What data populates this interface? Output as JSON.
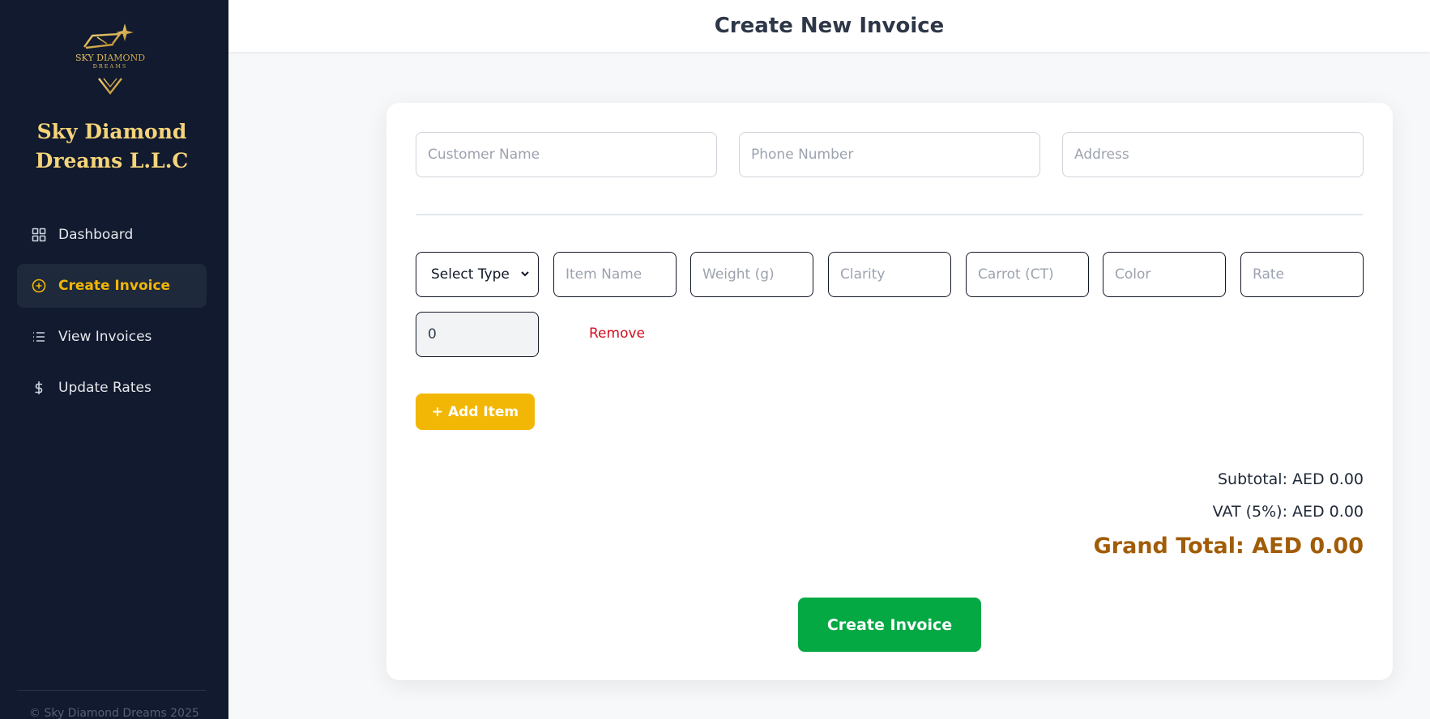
{
  "sidebar": {
    "logo_text": "SKY DIAMOND",
    "logo_subtext": "DREAMS",
    "brand_line1": "Sky Diamond",
    "brand_line2": "Dreams L.L.C",
    "items": [
      {
        "label": "Dashboard",
        "icon": "dashboard-grid-icon",
        "active": false
      },
      {
        "label": "Create Invoice",
        "icon": "plus-circle-icon",
        "active": true
      },
      {
        "label": "View Invoices",
        "icon": "list-icon",
        "active": false
      },
      {
        "label": "Update Rates",
        "icon": "dollar-icon",
        "active": false
      }
    ],
    "footer": "© Sky Diamond Dreams 2025"
  },
  "header": {
    "title": "Create New Invoice"
  },
  "customer": {
    "name_placeholder": "Customer Name",
    "phone_placeholder": "Phone Number",
    "address_placeholder": "Address"
  },
  "item_row": {
    "type_selected": "Select Type",
    "item_name_placeholder": "Item Name",
    "weight_placeholder": "Weight (g)",
    "clarity_placeholder": "Clarity",
    "carrot_placeholder": "Carrot (CT)",
    "color_placeholder": "Color",
    "rate_placeholder": "Rate",
    "amount_value": "0",
    "remove_label": "Remove"
  },
  "add_item_label": "+ Add Item",
  "totals": {
    "subtotal": "Subtotal: AED 0.00",
    "vat": "VAT (5%): AED 0.00",
    "grand_total": "Grand Total: AED 0.00"
  },
  "create_button_label": "Create Invoice",
  "colors": {
    "sidebar_bg": "#111a2e",
    "accent": "#f2b705",
    "brand": "#f5d47a",
    "danger": "#d10f1f",
    "success": "#04a944",
    "grand_total": "#a15c07"
  }
}
